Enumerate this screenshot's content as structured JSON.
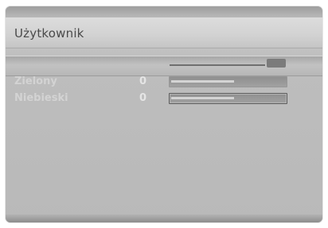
{
  "header": {
    "title": "Użytkownik"
  },
  "settings": [
    {
      "label": "Zielony",
      "value": "0",
      "level": 0.55
    },
    {
      "label": "Niebieski",
      "value": "0",
      "level": 0.55
    }
  ]
}
